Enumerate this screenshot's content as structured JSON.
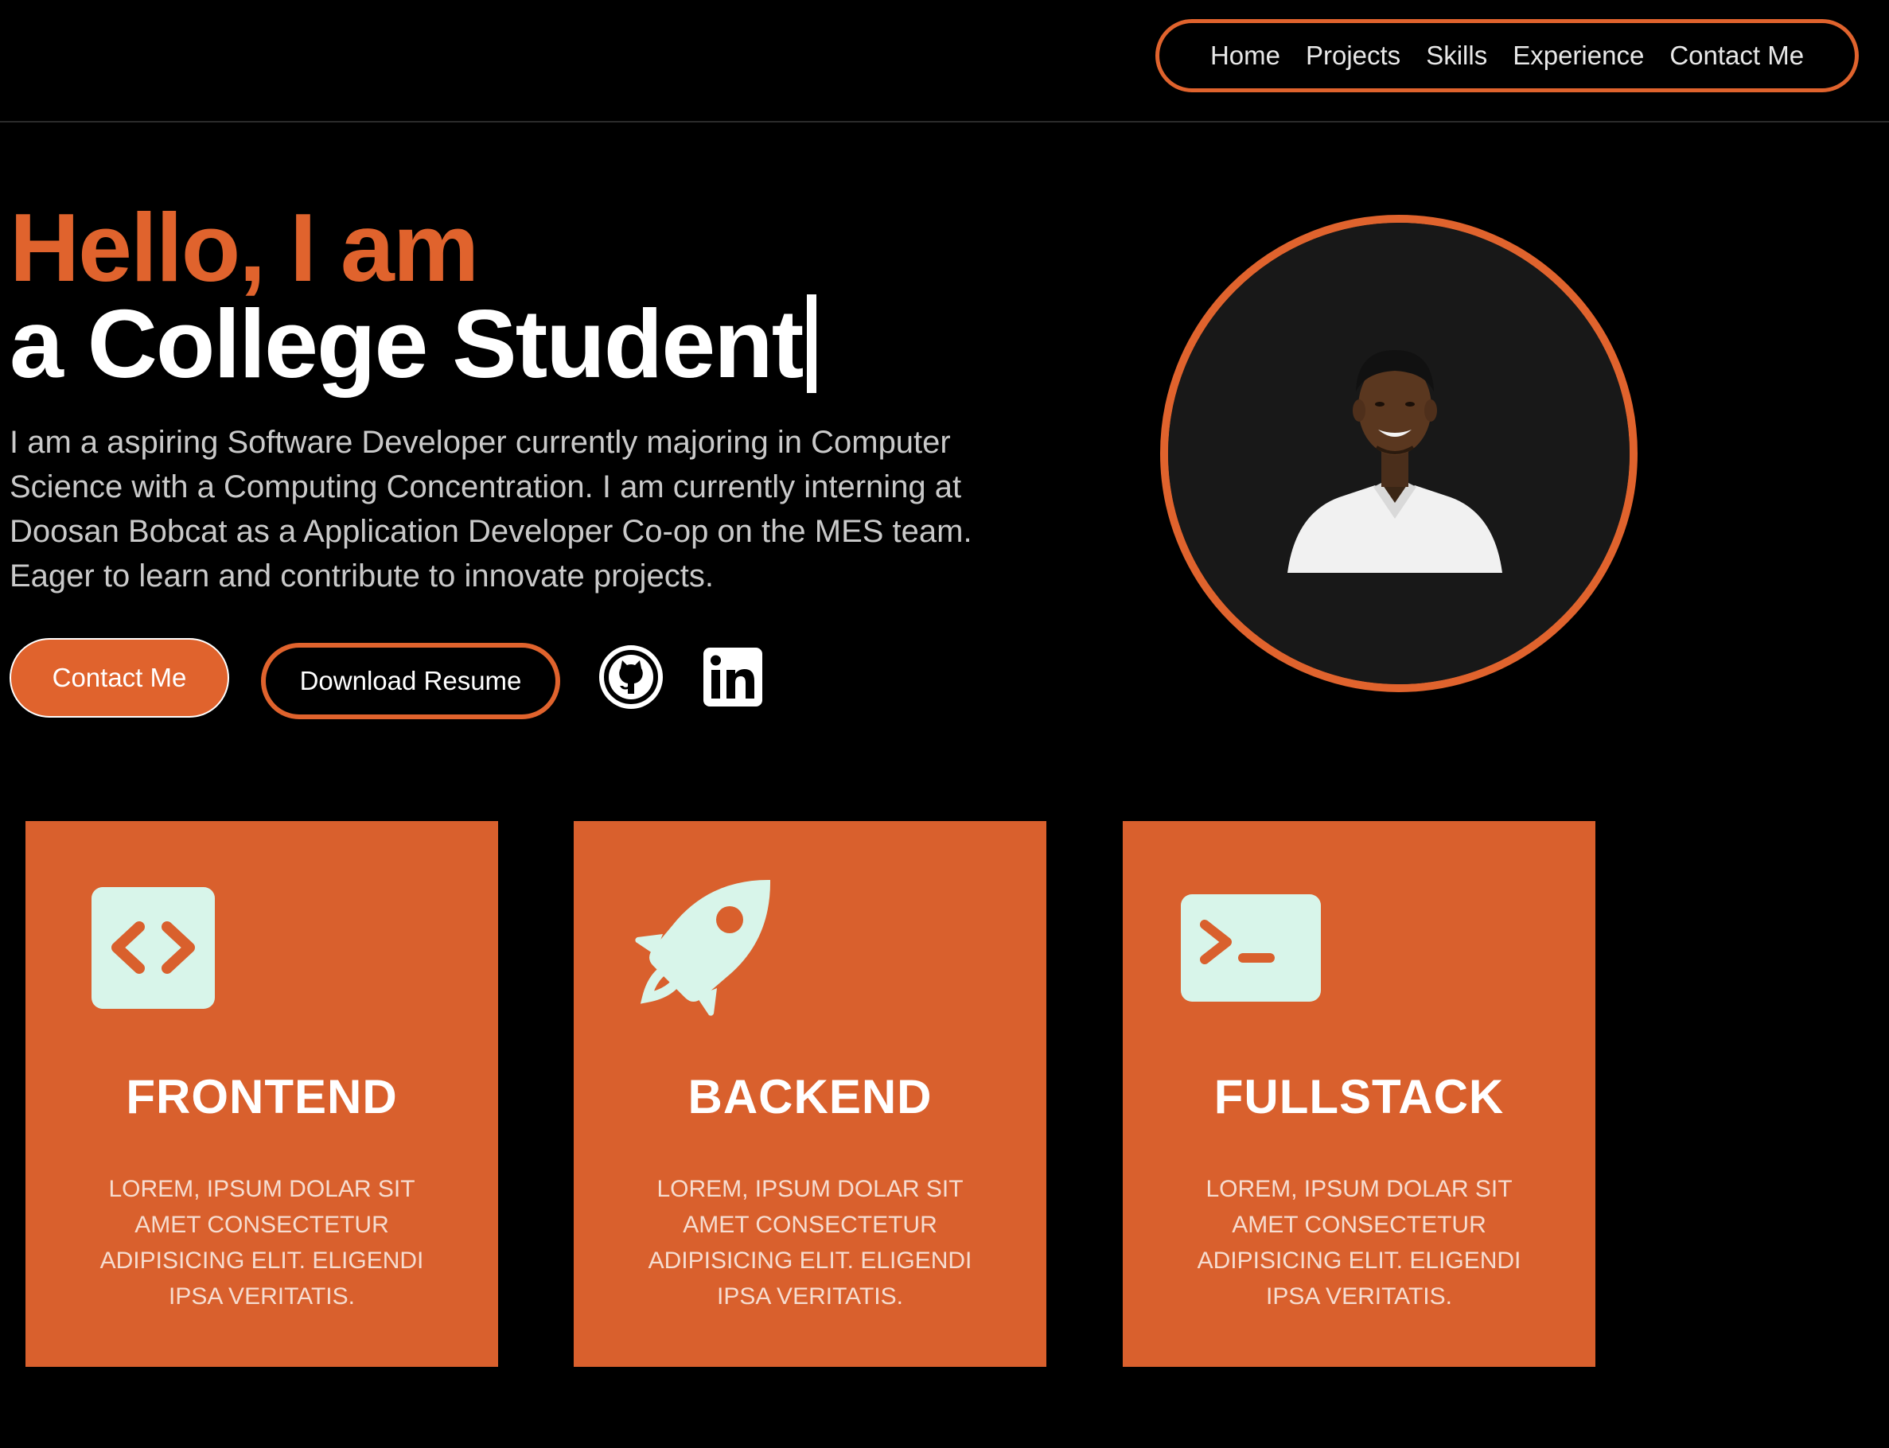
{
  "theme": {
    "accent": "#e0632d",
    "background": "#000000",
    "card_bg": "#d9602d",
    "icon_fill": "#d8f5ea"
  },
  "nav": {
    "items": [
      {
        "label": "Home"
      },
      {
        "label": "Projects"
      },
      {
        "label": "Skills"
      },
      {
        "label": "Experience"
      },
      {
        "label": "Contact Me"
      }
    ]
  },
  "hero": {
    "greeting": "Hello, I am",
    "role": "a College Student",
    "description": "I am a aspiring Software Developer currently majoring in Computer Science with a Computing Concentration. I am currently interning at Doosan Bobcat as a Application Developer Co-op on the MES team. Eager to learn and contribute to innovate projects.",
    "contact_button": "Contact Me",
    "resume_button": "Download Resume",
    "social": [
      {
        "icon": "github-icon"
      },
      {
        "icon": "linkedin-icon"
      }
    ]
  },
  "avatar": {
    "icon": "profile-photo"
  },
  "cards": [
    {
      "icon": "code-brackets-icon",
      "title": "FRONTEND",
      "text": "Lorem, ipsum dolar sit amet consectetur adipisicing elit. Eligendi ipsa veritatis."
    },
    {
      "icon": "rocket-icon",
      "title": "BACKEND",
      "text": "Lorem, ipsum dolar sit amet consectetur adipisicing elit. Eligendi ipsa veritatis."
    },
    {
      "icon": "terminal-icon",
      "title": "FULLSTACK",
      "text": "Lorem, ipsum dolar sit amet consectetur adipisicing elit. Eligendi ipsa veritatis."
    }
  ]
}
